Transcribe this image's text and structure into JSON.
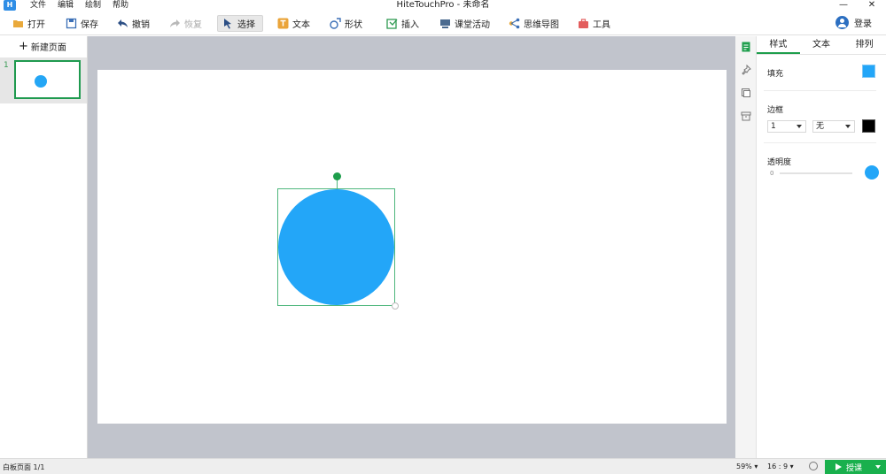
{
  "app": {
    "title": "HiteTouchPro - 未命名",
    "logo_icon": "app-logo-icon",
    "menu": [
      "文件",
      "编辑",
      "绘制",
      "帮助"
    ]
  },
  "toolbar": {
    "items": [
      {
        "label": "打开",
        "icon": "folder-icon",
        "disabled": false,
        "active": false
      },
      {
        "label": "保存",
        "icon": "save-icon",
        "disabled": false,
        "active": false
      },
      {
        "label": "撤销",
        "icon": "undo-icon",
        "disabled": false,
        "active": false
      },
      {
        "label": "恢复",
        "icon": "redo-icon",
        "disabled": true,
        "active": false
      },
      {
        "label": "选择",
        "icon": "select-arrow-icon",
        "disabled": false,
        "active": true
      },
      {
        "label": "文本",
        "icon": "text-icon",
        "disabled": false,
        "active": false
      },
      {
        "label": "形状",
        "icon": "shape-icon",
        "disabled": false,
        "active": false
      },
      {
        "label": "插入",
        "icon": "insert-icon",
        "disabled": false,
        "active": false
      },
      {
        "label": "课堂活动",
        "icon": "classroom-activity-icon",
        "disabled": false,
        "active": false
      },
      {
        "label": "思维导图",
        "icon": "mind-map-icon",
        "disabled": false,
        "active": false
      },
      {
        "label": "工具",
        "icon": "toolbox-icon",
        "disabled": false,
        "active": false
      }
    ],
    "login_label": "登录"
  },
  "pages_panel": {
    "new_page_label": "新建页面",
    "pages": [
      {
        "number": "1"
      }
    ]
  },
  "properties": {
    "tabs": [
      "样式",
      "文本",
      "排列"
    ],
    "fill_label": "填充",
    "fill_color": "#23a6f8",
    "border_label": "边框",
    "border_width": "1",
    "border_style": "无",
    "border_color": "#000000",
    "opacity_label": "透明度",
    "opacity_value": "0"
  },
  "status": {
    "page_info": "白板页面 1/1",
    "zoom": "59%",
    "ratio": "16 : 9",
    "teach_label": "授课"
  },
  "colors": {
    "accent_green": "#1e9e4c",
    "shape_blue": "#23a6f8",
    "canvas_bg": "#c1c4cc"
  }
}
